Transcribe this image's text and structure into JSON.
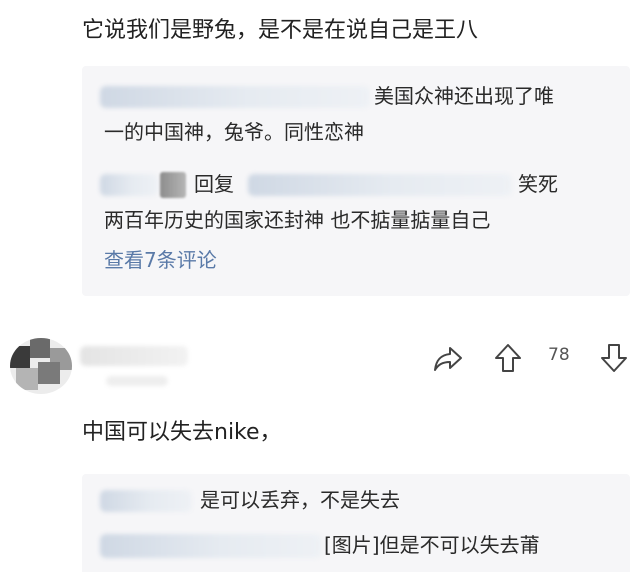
{
  "comments": [
    {
      "text": "它说我们是野兔，是不是在说自己是王八",
      "replies": [
        {
          "line1": "美国众神还出现了唯",
          "line2": "一的中国神，兔爷。同性恋神"
        },
        {
          "reply_word": "回复",
          "line1": "笑死",
          "line2": "两百年历史的国家还封神 也不掂量掂量自己"
        }
      ],
      "view_more": "查看7条评论"
    },
    {
      "vote_count": "78",
      "text": "中国可以失去nike，",
      "replies": [
        {
          "line1": "是可以丢弃，不是失去"
        },
        {
          "line1": "[图片]但是不可以失去莆"
        }
      ]
    }
  ],
  "icons": {
    "share": "share-icon",
    "upvote": "upvote-icon",
    "downvote": "downvote-icon"
  }
}
